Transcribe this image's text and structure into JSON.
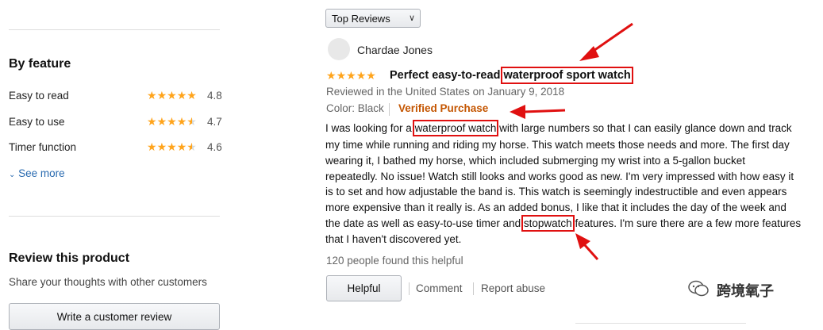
{
  "features": {
    "title": "By feature",
    "items": [
      {
        "label": "Easy to read",
        "rating": "4.8"
      },
      {
        "label": "Easy to use",
        "rating": "4.7"
      },
      {
        "label": "Timer function",
        "rating": "4.6"
      }
    ],
    "see_more": "See more"
  },
  "review_product": {
    "title": "Review this product",
    "subtitle": "Share your thoughts with other customers",
    "button": "Write a customer review"
  },
  "sort": {
    "selected": "Top Reviews"
  },
  "review": {
    "reviewer": "Chardae Jones",
    "title_prefix": "Perfect easy-to-read ",
    "title_highlight": "waterproof sport watch",
    "date_line": "Reviewed in the United States on January 9, 2018",
    "color": "Color: Black",
    "verified": "Verified Purchase",
    "line1_a": "I was looking for a ",
    "line1_hl": "waterproof watch",
    "line1_b": " with large numbers so that I can easily glance down and track",
    "line2": "my time while running and riding my horse. This watch meets those needs and more. The first day",
    "line3": "wearing it, I bathed my horse, which included submerging my wrist into a 5-gallon bucket",
    "line4": "repeatedly. No issue! Watch still looks and works good as new. I'm very impressed with how easy it",
    "line5": "is to set and how adjustable the band is. This watch is seemingly indestructible and even appears",
    "line6": "more expensive than it really is. As an added bonus, I like that it includes the day of the week and",
    "line7_a": "the date as well as easy-to-use timer and ",
    "line7_hl": "stopwatch",
    "line7_b": " features. I'm sure there are a few more features",
    "line8": "that I haven't discovered yet.",
    "helpful_count": "120 people found this helpful",
    "helpful_button": "Helpful",
    "comment": "Comment",
    "report": "Report abuse"
  },
  "watermark": "跨境氧子",
  "colors": {
    "star": "#ffa41c",
    "verified": "#c45500",
    "link": "#2a6bb0",
    "annotation": "#e01010"
  }
}
